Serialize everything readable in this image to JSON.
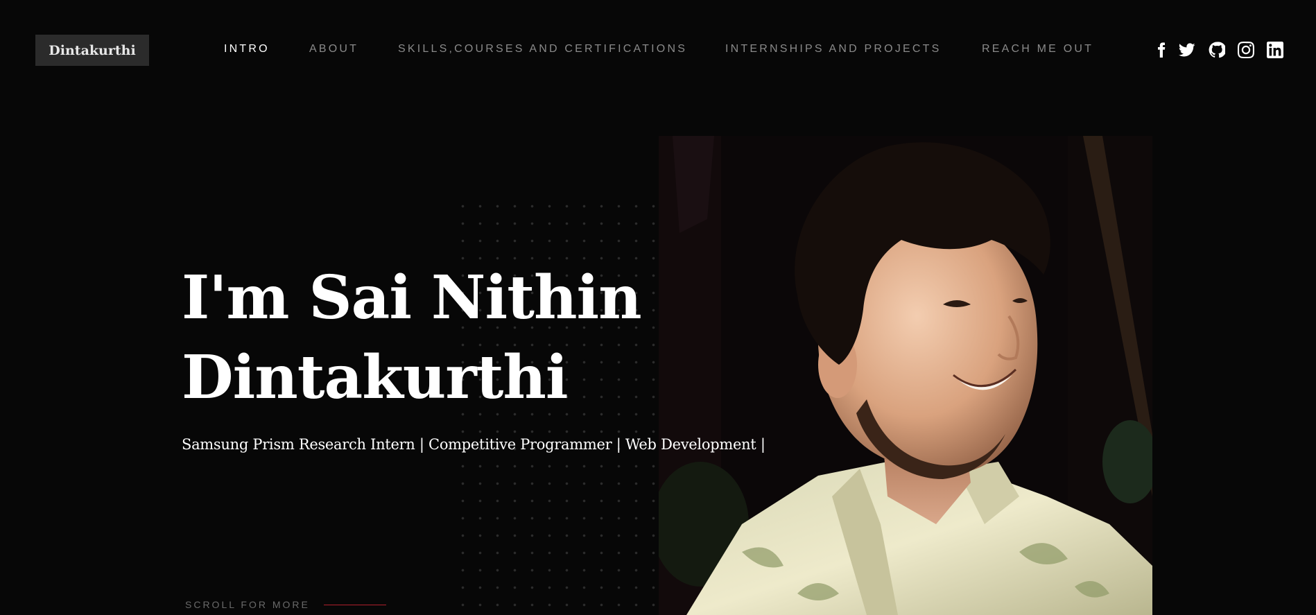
{
  "header": {
    "logo_text": "Dintakurthi",
    "nav": [
      {
        "label": "INTRO",
        "active": true
      },
      {
        "label": "ABOUT",
        "active": false
      },
      {
        "label": "SKILLS,COURSES AND CERTIFICATIONS",
        "active": false
      },
      {
        "label": "INTERNSHIPS AND PROJECTS",
        "active": false
      },
      {
        "label": "REACH ME OUT",
        "active": false
      }
    ],
    "socials": [
      "facebook-icon",
      "twitter-icon",
      "github-icon",
      "instagram-icon",
      "linkedin-icon"
    ]
  },
  "hero": {
    "title_line1": "I'm Sai Nithin",
    "title_line2": "Dintakurthi",
    "subtitle": "Samsung Prism Research Intern | Competitive Programmer | Web Development |",
    "scroll_label": "SCROLL FOR MORE"
  },
  "colors": {
    "background": "#070707",
    "accent": "#b0202c",
    "nav_inactive": "#8a8a8a",
    "nav_active": "#ffffff"
  }
}
